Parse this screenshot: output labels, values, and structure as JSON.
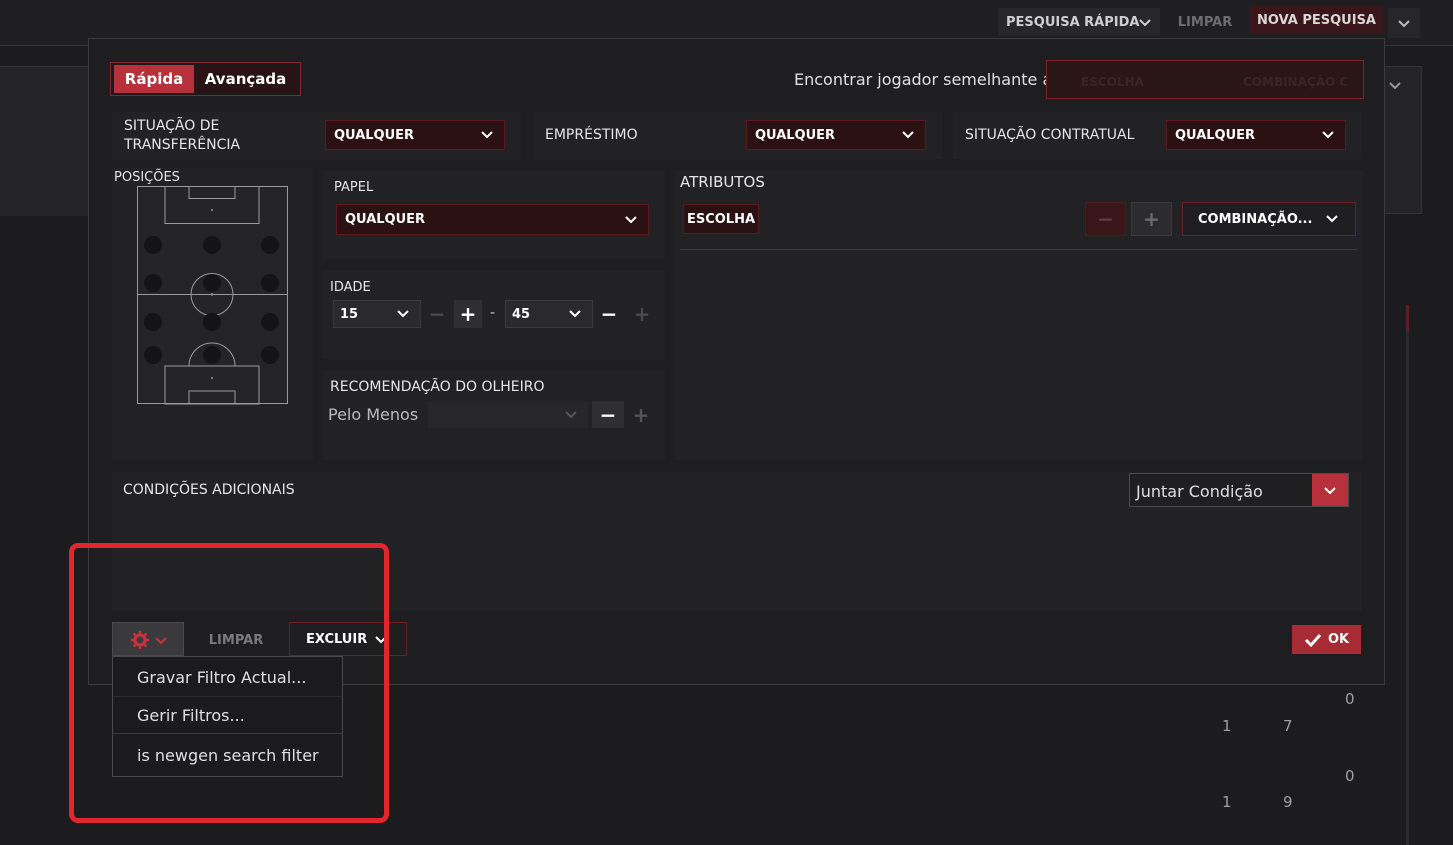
{
  "top_bar": {
    "quick_search": "PESQUISA RÁPIDA",
    "clear": "LIMPAR",
    "new_search": "NOVA PESQUISA"
  },
  "dialog": {
    "tabs": {
      "quick": "Rápida",
      "advanced": "Avançada"
    },
    "similar_player": {
      "label": "Encontrar jogador semelhante a",
      "choose": "ESCOLHA",
      "combination": "COMBINAÇÃO C"
    },
    "filters": {
      "transfer_status": {
        "label_line1": "SITUAÇÃO DE",
        "label_line2": "TRANSFERÊNCIA",
        "value": "QUALQUER"
      },
      "loan": {
        "label": "EMPRÉSTIMO",
        "value": "QUALQUER"
      },
      "contract_status": {
        "label": "SITUAÇÃO CONTRATUAL",
        "value": "QUALQUER"
      }
    },
    "positions": {
      "label": "POSIÇÕES"
    },
    "role": {
      "label": "PAPEL",
      "value": "QUALQUER"
    },
    "age": {
      "label": "IDADE",
      "min": "15",
      "max": "45",
      "separator": "-"
    },
    "scout": {
      "label": "RECOMENDAÇÃO DO OLHEIRO",
      "prefix": "Pelo Menos",
      "value": ""
    },
    "attributes": {
      "label": "ATRIBUTOS",
      "choose": "ESCOLHA",
      "combination": "COMBINAÇÃO..."
    },
    "additional": {
      "label": "CONDIÇÕES ADICIONAIS",
      "join": "Juntar Condição"
    },
    "footer": {
      "clear": "LIMPAR",
      "exclude": "EXCLUIR",
      "ok": "OK"
    }
  },
  "gear_menu": {
    "items": [
      "Gravar Filtro Actual...",
      "Gerir Filtros...",
      "is newgen search filter"
    ]
  },
  "background_numbers": [
    "0",
    "1",
    "7",
    "0",
    "1",
    "9"
  ],
  "icons": {
    "gear": "gear-icon",
    "chevron": "chevron-down-icon",
    "check": "check-icon"
  },
  "colors": {
    "accent": "#c8313d",
    "highlight": "#e3262d",
    "panel": "#222225"
  }
}
